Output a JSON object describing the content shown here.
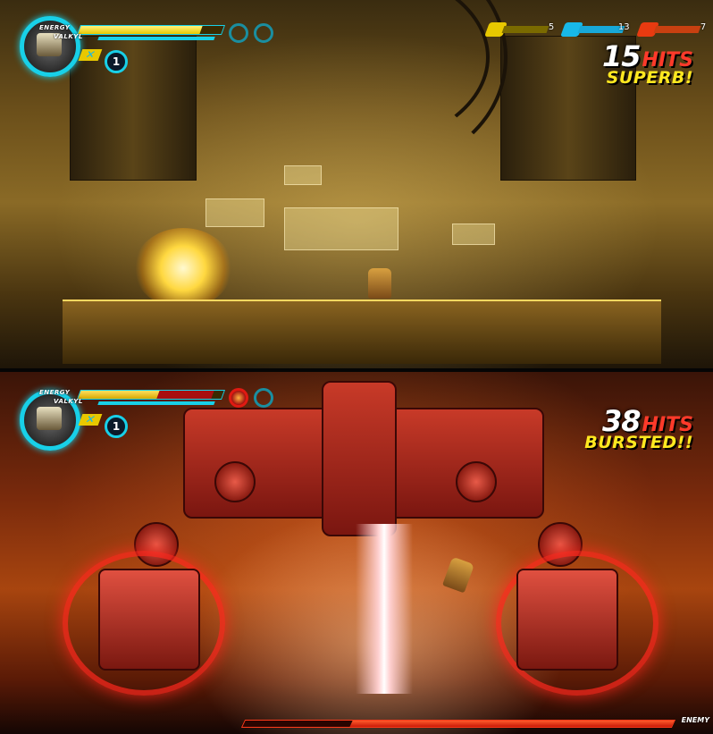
{
  "top_screen": {
    "hud": {
      "energy_label": "ENERGY",
      "player_name": "VALKYL",
      "energy_fraction": 0.85,
      "lives": "1",
      "weapon_icon": "cross-weapon-icon"
    },
    "items": [
      {
        "icon": "yellow-canister-icon",
        "count": "5",
        "color": "#e8c800"
      },
      {
        "icon": "cyan-shield-icon",
        "count": "13",
        "color": "#18b8e8"
      },
      {
        "icon": "red-canister-icon",
        "count": "7",
        "color": "#e83a10"
      }
    ],
    "combo": {
      "count": "15",
      "word": "HITS",
      "rank": "SUPERB!"
    }
  },
  "bottom_screen": {
    "hud": {
      "energy_label": "ENERGY",
      "player_name": "VALKYL",
      "energy_fraction": 0.55,
      "lives": "1",
      "weapon_icon": "cross-weapon-icon"
    },
    "combo": {
      "count": "38",
      "word": "HITS",
      "rank": "BURSTED!!"
    },
    "enemy": {
      "label": "ENEMY",
      "health_fraction": 0.75
    }
  },
  "colors": {
    "hud_cyan": "#18d0e8",
    "energy_yellow": "#e8c800",
    "combo_red": "#ff3a2a",
    "rank_yellow": "#ffe820"
  }
}
